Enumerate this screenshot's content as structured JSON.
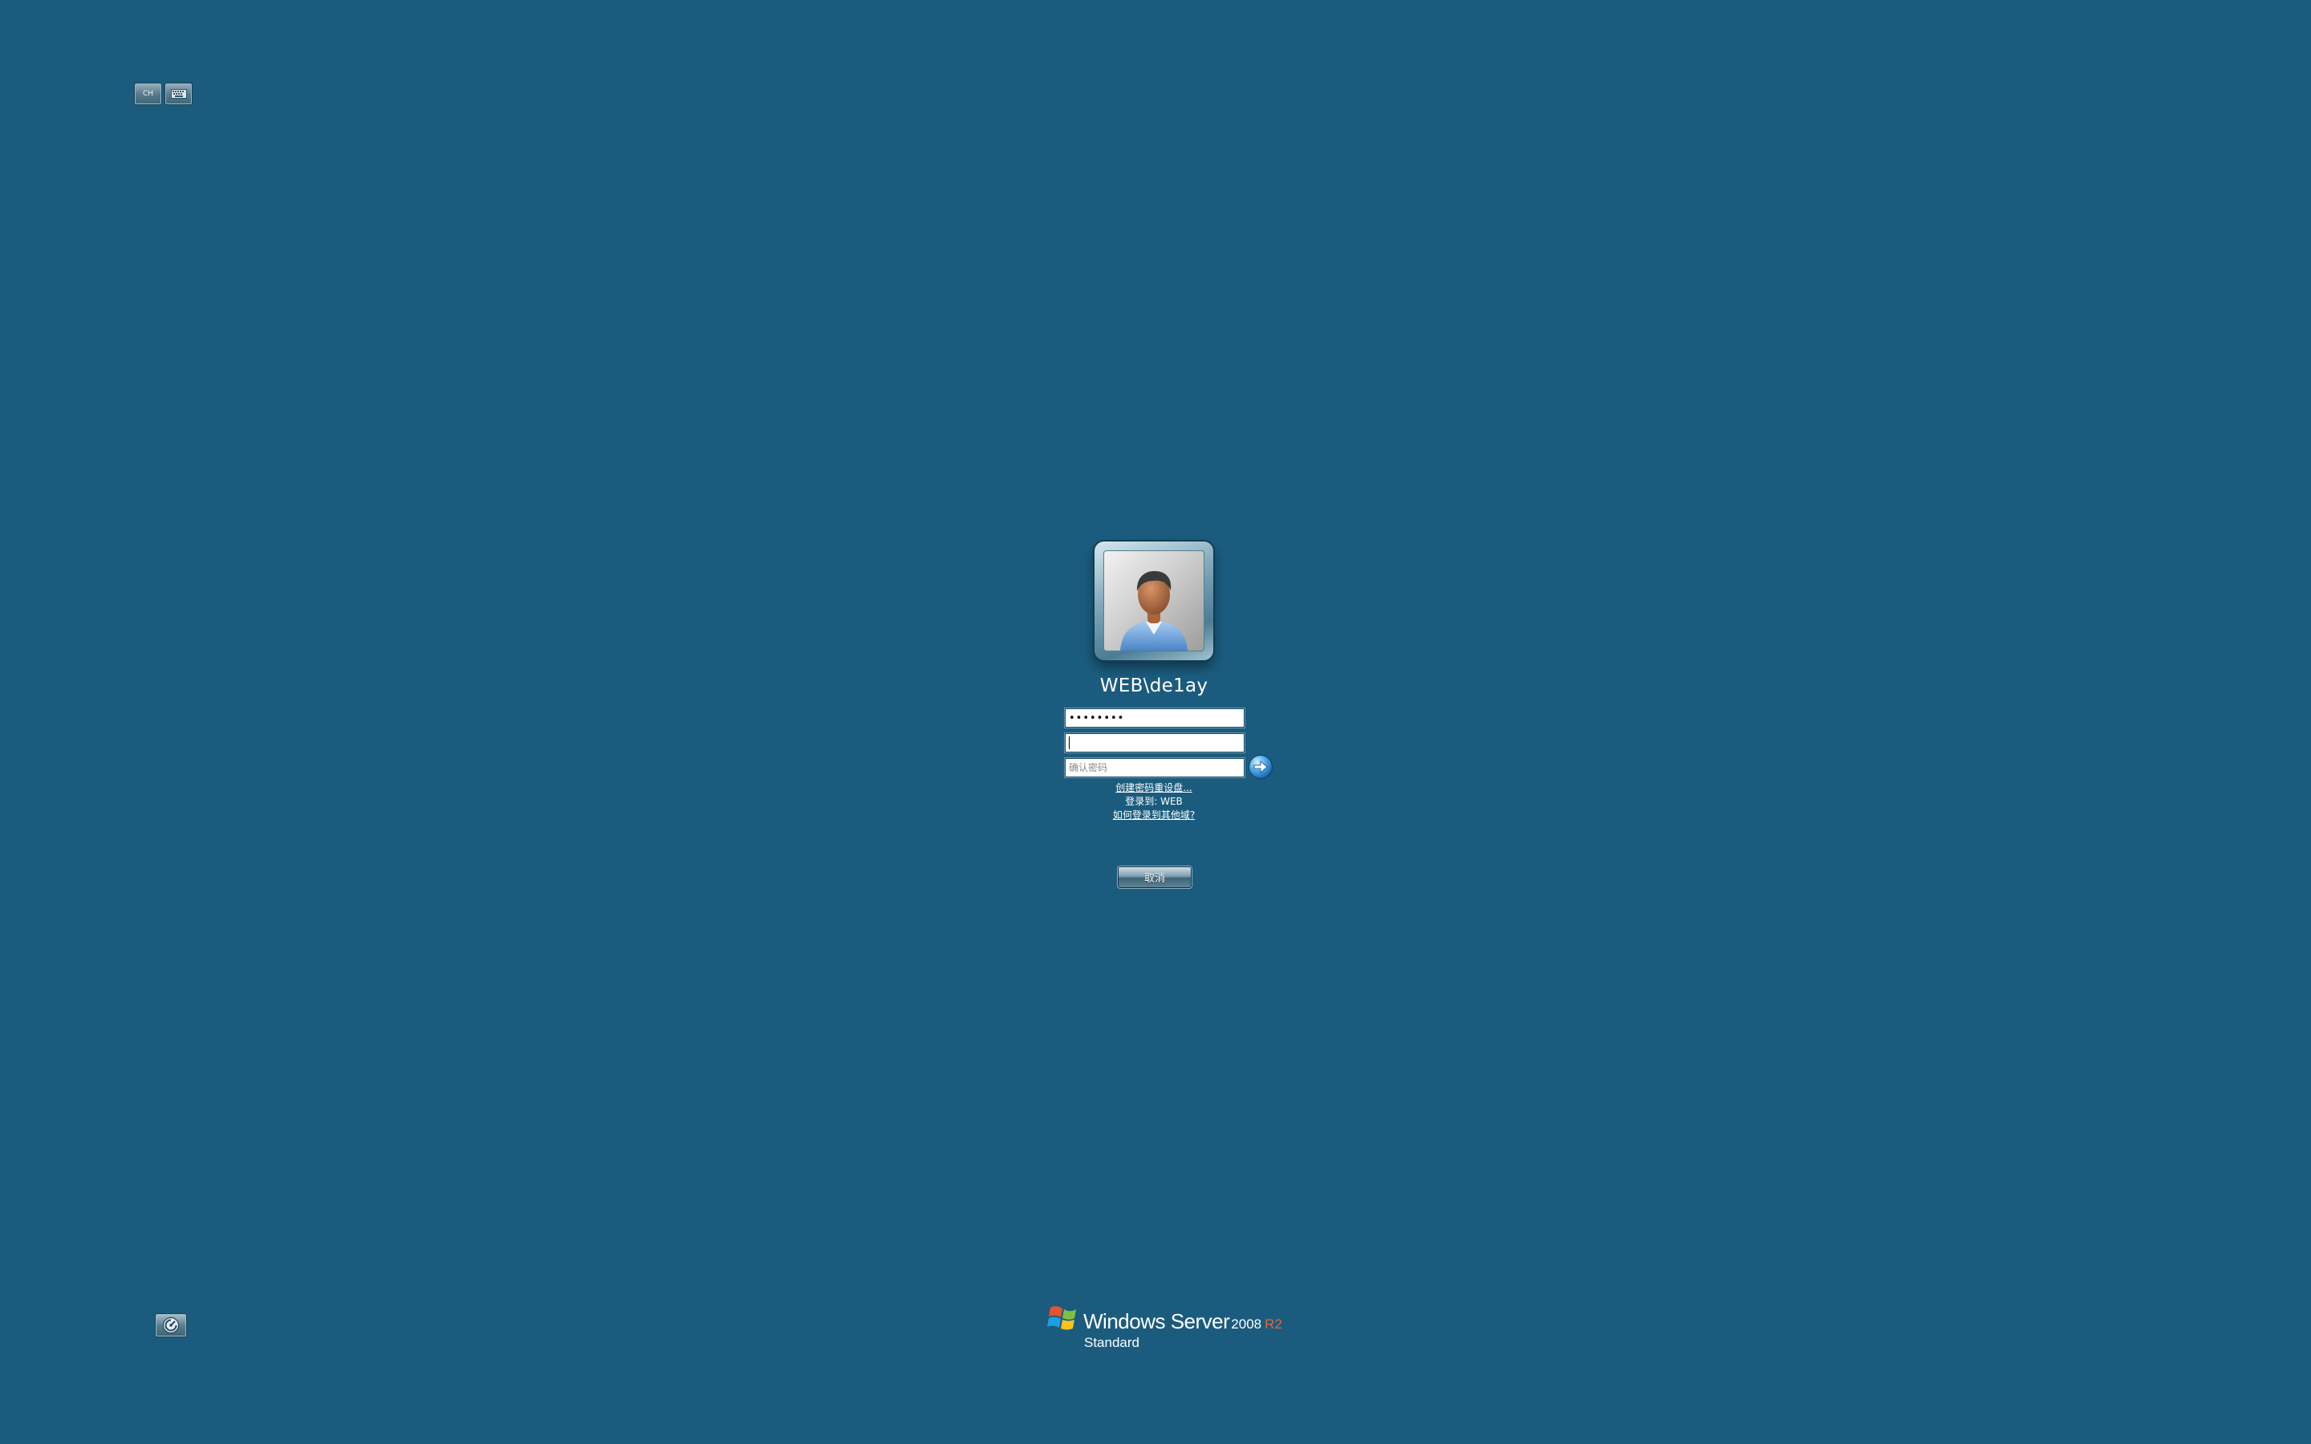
{
  "toolbar": {
    "language_label": "CH",
    "keyboard_icon": "keyboard-icon"
  },
  "user": {
    "avatar_icon": "user-avatar-icon",
    "name": "WEB\\de1ay"
  },
  "form": {
    "old_password_value": "••••••••",
    "new_password_value": "",
    "confirm_password_placeholder": "确认密码",
    "submit_icon": "arrow-right-icon"
  },
  "links": {
    "reset_disk": "创建密码重设盘...",
    "logon_to": "登录到: WEB",
    "other_domain": "如何登录到其他域?"
  },
  "actions": {
    "cancel_label": "取消",
    "ease_of_access_icon": "ease-of-access-icon"
  },
  "branding": {
    "name": "Windows Server",
    "version": "2008",
    "release": "R2",
    "edition": "Standard"
  },
  "colors": {
    "background": "#1b5c7e",
    "r2_accent": "#e0673a"
  }
}
